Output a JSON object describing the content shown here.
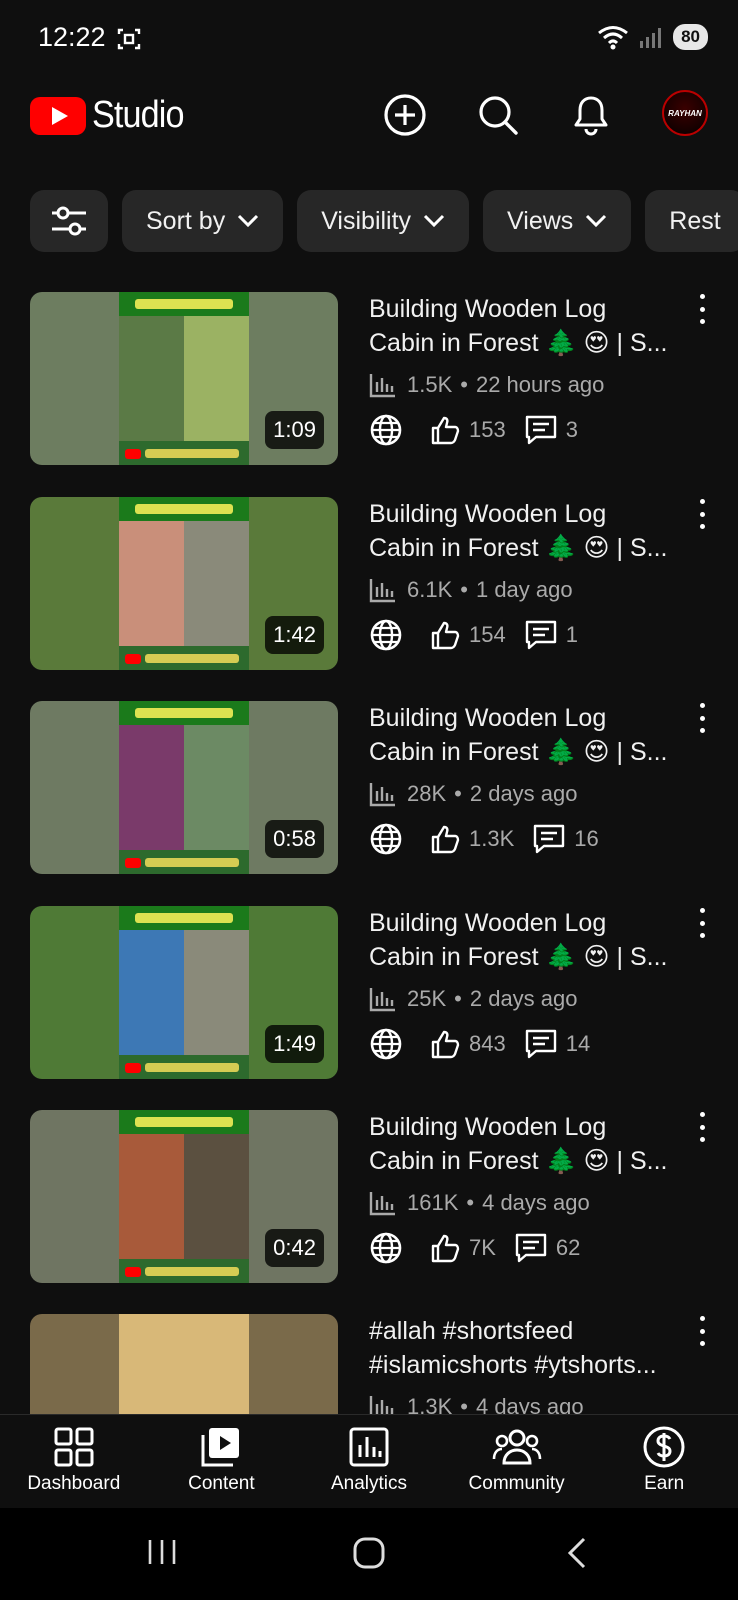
{
  "status": {
    "time": "12:22",
    "battery": "80"
  },
  "header": {
    "title": "Studio",
    "avatar_text": "RAYHAN"
  },
  "filters": [
    "Sort by",
    "Visibility",
    "Views",
    "Rest"
  ],
  "videos": [
    {
      "title_line1": "Building Wooden Log",
      "title_line2": "Cabin in Forest 🌲 😍 | S...",
      "views": "1.5K",
      "age": "22 hours ago",
      "likes": "153",
      "comments": "3",
      "duration": "1:09",
      "thumb": {
        "bg": "#6d7d60",
        "left": "#5b7a46",
        "right": "#9bb263"
      }
    },
    {
      "title_line1": "Building Wooden Log",
      "title_line2": "Cabin in Forest 🌲 😍 | S...",
      "views": "6.1K",
      "age": "1 day ago",
      "likes": "154",
      "comments": "1",
      "duration": "1:42",
      "thumb": {
        "bg": "#5a7a3a",
        "left": "#c98f7a",
        "right": "#8a8a7a"
      }
    },
    {
      "title_line1": "Building Wooden Log",
      "title_line2": "Cabin in Forest 🌲 😍 | S...",
      "views": "28K",
      "age": "2 days ago",
      "likes": "1.3K",
      "comments": "16",
      "duration": "0:58",
      "thumb": {
        "bg": "#6e7a62",
        "left": "#7a3a6a",
        "right": "#6c8a64"
      }
    },
    {
      "title_line1": "Building Wooden Log",
      "title_line2": "Cabin in Forest 🌲 😍 | S...",
      "views": "25K",
      "age": "2 days ago",
      "likes": "843",
      "comments": "14",
      "duration": "1:49",
      "thumb": {
        "bg": "#4f7a36",
        "left": "#3d78b5",
        "right": "#8a8a7a"
      }
    },
    {
      "title_line1": "Building Wooden Log",
      "title_line2": "Cabin in Forest 🌲 😍 | S...",
      "views": "161K",
      "age": "4 days ago",
      "likes": "7K",
      "comments": "62",
      "duration": "0:42",
      "thumb": {
        "bg": "#6f7562",
        "left": "#a85a3a",
        "right": "#5b5040"
      }
    },
    {
      "title_line1": "#allah #shortsfeed",
      "title_line2": "#islamicshorts #ytshorts...",
      "views": "1.3K",
      "age": "4 days ago",
      "likes": "",
      "comments": "",
      "duration": "",
      "thumb": {
        "bg": "#7a6a4a",
        "left": "#c8a868",
        "right": "#c8a868"
      }
    }
  ],
  "nav": [
    "Dashboard",
    "Content",
    "Analytics",
    "Community",
    "Earn"
  ],
  "colors": {
    "background": "#0f0f0f",
    "chip": "#272727",
    "brand_red": "#ff0000",
    "secondary_text": "#aaaaaa"
  }
}
